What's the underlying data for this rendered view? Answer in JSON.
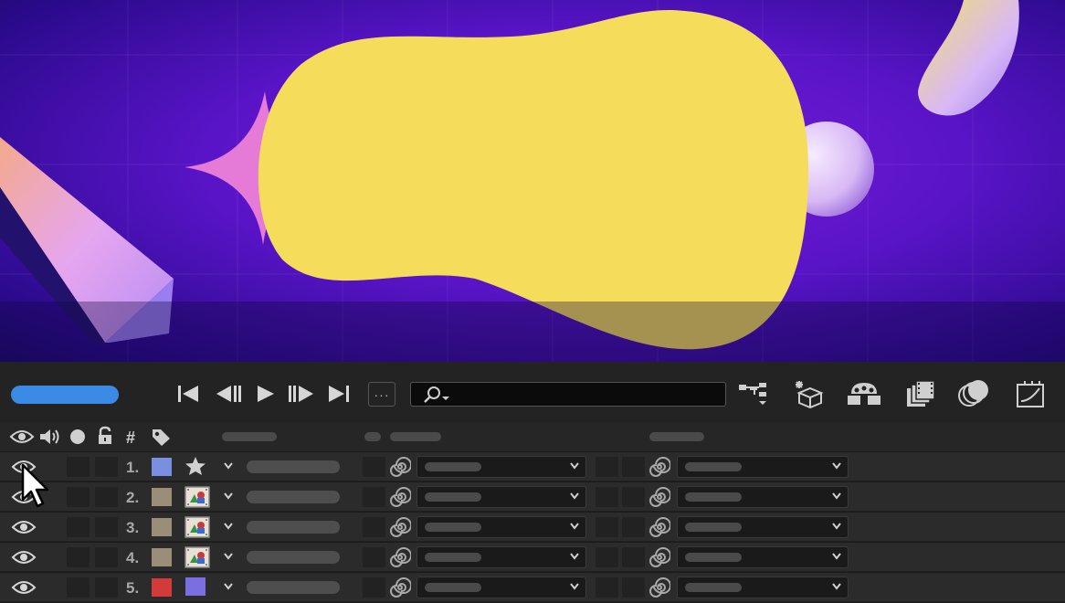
{
  "canvas": {
    "background_colors": [
      "#7a1fd6",
      "#2a0a8c"
    ],
    "blob_color": "#f5dc5a",
    "sphere_color": "#e9ccff",
    "star_color": "#e67ad7"
  },
  "toolbar": {
    "progress_color": "#3b8be6",
    "transport": [
      "first-frame-icon",
      "previous-frame-icon",
      "play-icon",
      "next-frame-icon",
      "last-frame-icon"
    ],
    "more_label": "···",
    "search": {
      "placeholder": "",
      "icon": "search-icon"
    },
    "tools": [
      "node-hierarchy-icon",
      "3d-cube-icon",
      "brainstorm-icon",
      "composition-icon",
      "motion-blur-icon",
      "graph-editor-icon"
    ]
  },
  "columns": {
    "icons": [
      "eye-icon",
      "audio-icon",
      "solo-icon",
      "lock-icon"
    ],
    "number_header": "#",
    "label_icon": "tag-icon"
  },
  "layers": [
    {
      "number": "1.",
      "label_color": "#7b8fe0",
      "type_icon": "star-icon"
    },
    {
      "number": "2.",
      "label_color": "#9a8e78",
      "type_icon": "footage-icon"
    },
    {
      "number": "3.",
      "label_color": "#9a8e78",
      "type_icon": "footage-icon"
    },
    {
      "number": "4.",
      "label_color": "#9a8e78",
      "type_icon": "footage-icon"
    },
    {
      "number": "5.",
      "label_color": "#d33a3a",
      "type_icon": "solid-icon"
    }
  ]
}
